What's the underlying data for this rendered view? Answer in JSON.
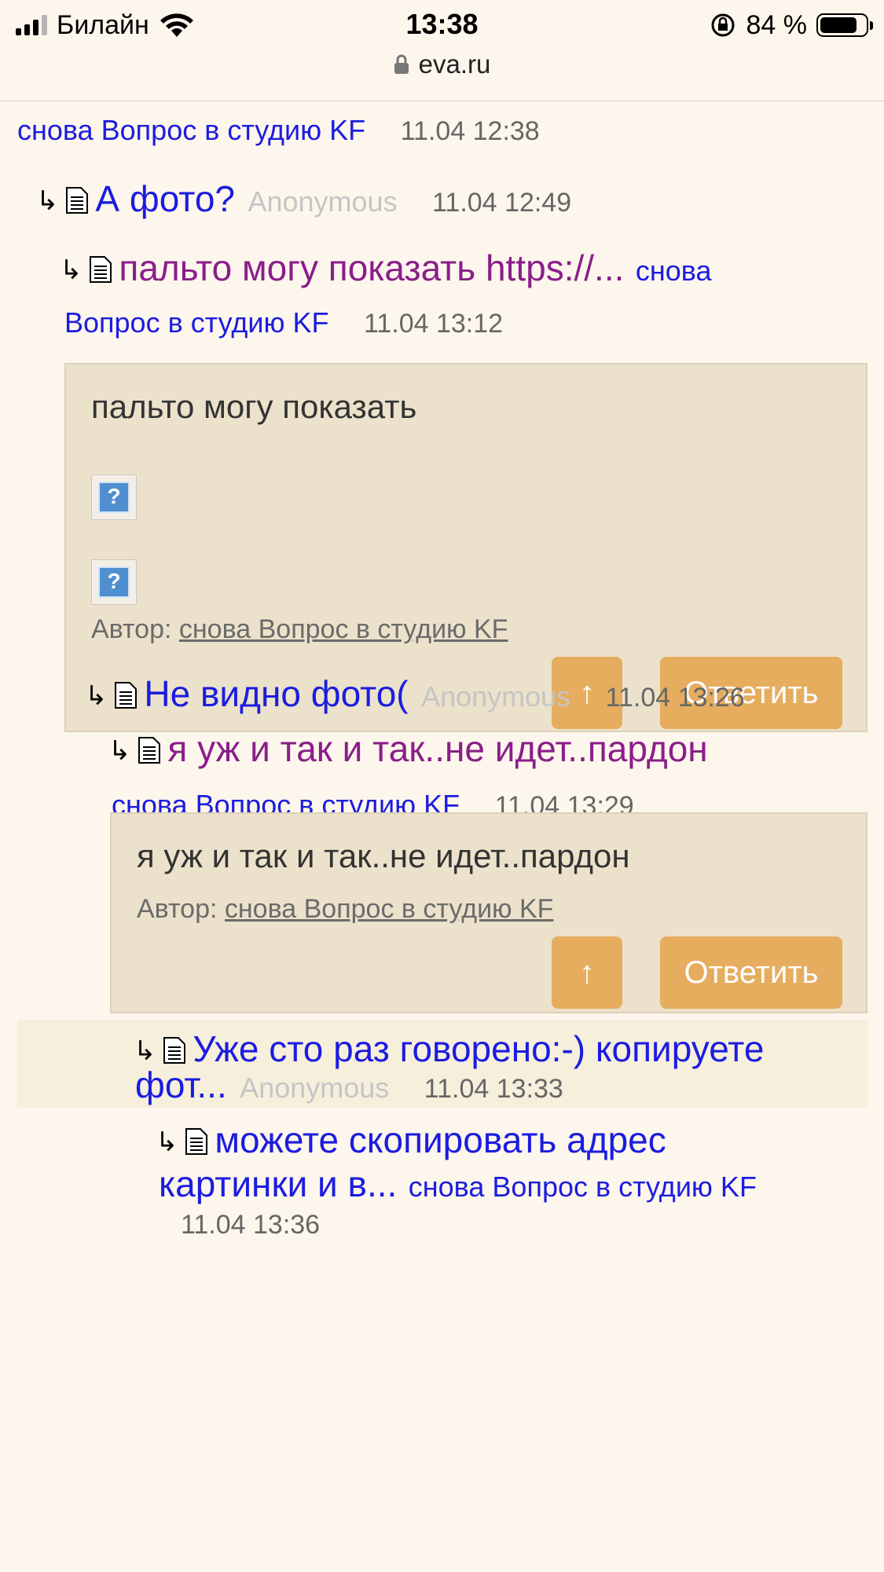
{
  "status_bar": {
    "carrier": "Билайн",
    "time": "13:38",
    "battery_percent": "84 %",
    "url": "eva.ru"
  },
  "thread": [
    {
      "kind": "tail",
      "author": "снова Вопрос в студию KF",
      "date": "11.04 12:38"
    },
    {
      "kind": "reply",
      "title": "А фото?",
      "author": "Anonymous",
      "date": "11.04 12:49"
    },
    {
      "kind": "reply",
      "title": "пальто могу показать https://...",
      "author": "снова Вопрос в студию KF",
      "author_line2": "Вопрос в студию KF",
      "author_line1": "снова",
      "date": "11.04 13:12",
      "body": "пальто могу показать",
      "author_label": "Автор:",
      "author_link": "снова Вопрос в студию KF"
    },
    {
      "kind": "reply",
      "title": "Не видно фото(",
      "author": "Anonymous",
      "date": "11.04 13:26"
    },
    {
      "kind": "reply",
      "title": "я уж и так и так..не идет..пардон",
      "author": "снова Вопрос в студию KF",
      "date": "11.04 13:29",
      "body": "я уж и так и так..не идет..пардон",
      "author_label": "Автор:",
      "author_link": "снова Вопрос в студию KF"
    },
    {
      "kind": "reply",
      "title_line1": "Уже сто раз говорено:-) копируете",
      "title_line2": "фот...",
      "author": "Anonymous",
      "date": "11.04 13:33"
    },
    {
      "kind": "reply",
      "title_line1": "можете скопировать адрес",
      "title_line2": "картинки и в...",
      "author": "снова Вопрос в студию KF",
      "date": "11.04 13:36"
    }
  ],
  "buttons": {
    "up_symbol": "↑",
    "reply_label": "Ответить"
  },
  "icons": {
    "reply_arrow": "↳",
    "broken_image": "?"
  }
}
